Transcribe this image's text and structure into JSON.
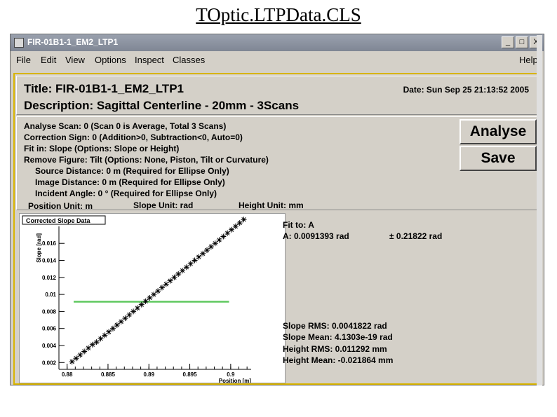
{
  "slide_title": "TOptic.LTPData.CLS",
  "window": {
    "title": "FIR-01B1-1_EM2_LTP1",
    "controls": [
      "_",
      "□",
      "X"
    ]
  },
  "menu": {
    "items": [
      "File",
      "Edit",
      "View",
      "Options",
      "Inspect",
      "Classes"
    ],
    "help": "Help"
  },
  "header": {
    "title": "Title: FIR-01B1-1_EM2_LTP1",
    "description": "Description: Sagittal Centerline - 20mm - 3Scans",
    "date": "Date: Sun Sep 25 21:13:52 2005"
  },
  "params": {
    "analyse_scan": "Analyse Scan: 0   (Scan 0 is Average, Total 3 Scans)",
    "correction_sign": "Correction Sign: 0  (Addition>0, Subtraction<0, Auto=0)",
    "fit_in": "Fit in: Slope  (Options: Slope or Height)",
    "remove_figure": "Remove Figure: Tilt   (Options: None, Piston, Tilt or Curvature)",
    "source_distance": "Source Distance: 0 m     (Required for Ellipse Only)",
    "image_distance": "Image Distance: 0 m     (Required for Ellipse Only)",
    "incident_angle": "Incident Angle: 0 °     (Required for Ellipse Only)",
    "position_unit": "Position Unit: m",
    "slope_unit": "Slope Unit: rad",
    "height_unit": "Height Unit: mm"
  },
  "buttons": {
    "analyse": "Analyse",
    "save": "Save"
  },
  "fit": {
    "fit_to": "Fit to: A",
    "a_label": "A",
    "a_value": ": 0.0091393 rad",
    "a_error": "±  0.21822 rad"
  },
  "stats": {
    "slope_rms": "Slope RMS: 0.0041822 rad",
    "slope_mean": "Slope Mean: 4.1303e-19 rad",
    "height_rms": "Height RMS: 0.011292 mm",
    "height_mean": "Height Mean:  -0.021864 mm"
  },
  "colors": {
    "fit_line": "#5ec85e",
    "accent_border": "#d8b400",
    "titlebar": "#8a91a0"
  },
  "chart_data": {
    "type": "scatter",
    "title": "Corrected Slope Data",
    "xlabel": "Position [m]",
    "ylabel": "Slope [rad]",
    "xlim": [
      0.879,
      0.9025
    ],
    "ylim": [
      0.0012,
      0.0175
    ],
    "xticks": [
      "0.88",
      "0.885",
      "0.89",
      "0.895",
      "0.9"
    ],
    "yticks": [
      "0.002",
      "0.004",
      "0.006",
      "0.008",
      "0.01",
      "0.012",
      "0.014",
      "0.016"
    ],
    "series": [
      {
        "marker": "star",
        "x": [
          0.8806,
          0.8811,
          0.8816,
          0.8821,
          0.8826,
          0.8831,
          0.8836,
          0.8841,
          0.8846,
          0.8851,
          0.8856,
          0.8861,
          0.8866,
          0.8871,
          0.8876,
          0.8881,
          0.8886,
          0.8891,
          0.8896,
          0.8901,
          0.8906,
          0.8911,
          0.8916,
          0.8921,
          0.8926,
          0.8931,
          0.8936,
          0.8941,
          0.8946,
          0.8951,
          0.8956,
          0.8961,
          0.8966,
          0.8971,
          0.8976,
          0.8981,
          0.8986,
          0.8991,
          0.8996,
          0.9001,
          0.9006,
          0.9011,
          0.9016
        ],
        "y": [
          0.0021,
          0.0025,
          0.0029,
          0.0033,
          0.0037,
          0.0041,
          0.0044,
          0.0048,
          0.0052,
          0.0056,
          0.006,
          0.0064,
          0.0068,
          0.0072,
          0.0076,
          0.008,
          0.0084,
          0.0088,
          0.0092,
          0.0096,
          0.01,
          0.0104,
          0.0108,
          0.0112,
          0.0116,
          0.012,
          0.0124,
          0.0128,
          0.0132,
          0.0136,
          0.014,
          0.0144,
          0.0148,
          0.0152,
          0.0156,
          0.016,
          0.0164,
          0.0168,
          0.0172,
          0.0176,
          0.018,
          0.0184,
          0.0188
        ]
      }
    ],
    "fit_line": {
      "y": 0.0091393,
      "x": [
        0.8808,
        0.8998
      ]
    },
    "grid": false
  }
}
